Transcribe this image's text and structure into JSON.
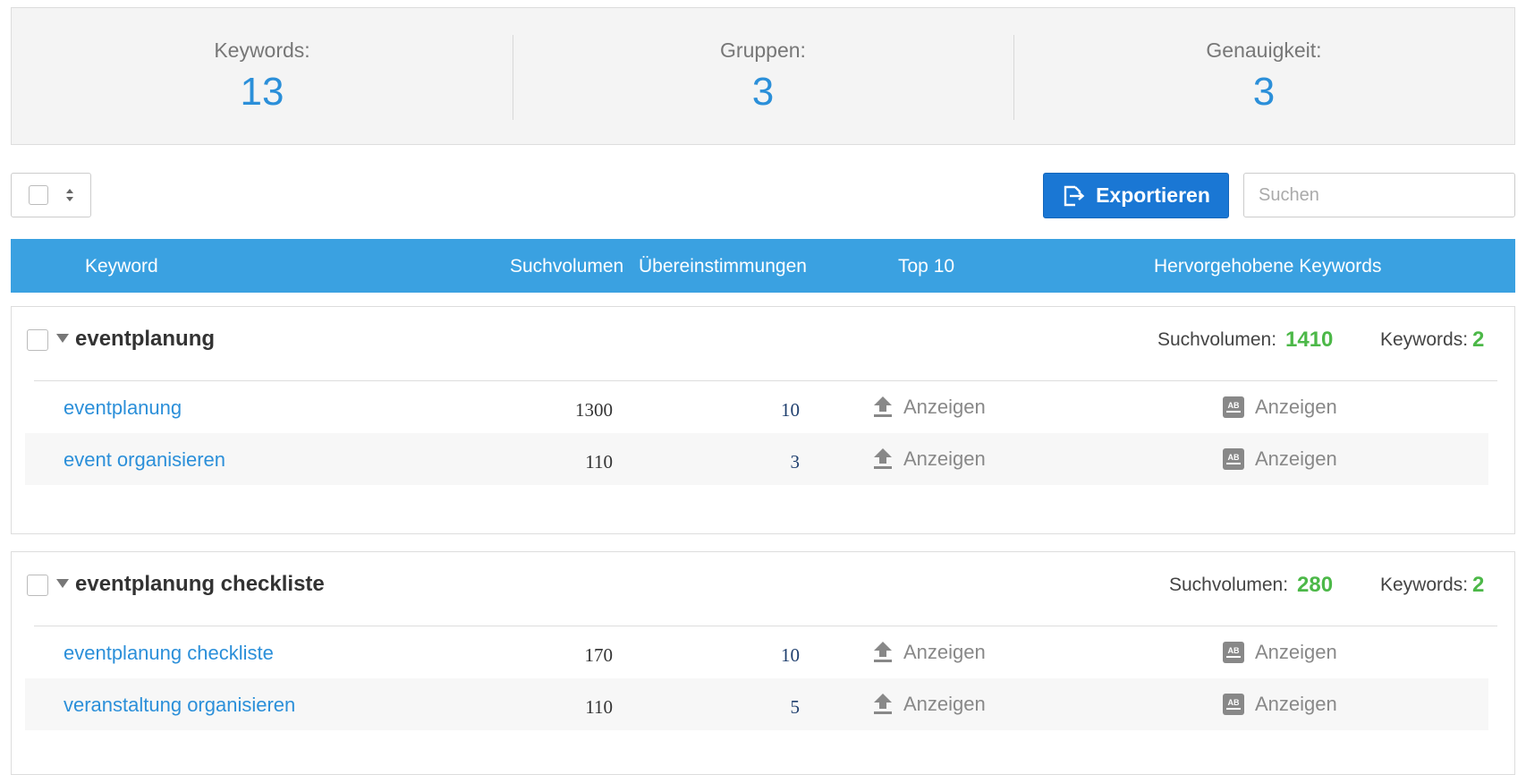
{
  "stats": [
    {
      "label": "Keywords:",
      "value": "13"
    },
    {
      "label": "Gruppen:",
      "value": "3"
    },
    {
      "label": "Genauigkeit:",
      "value": "3"
    }
  ],
  "toolbar": {
    "export_label": "Exportieren",
    "search_placeholder": "Suchen"
  },
  "table": {
    "headers": {
      "keyword": "Keyword",
      "volume": "Suchvolumen",
      "matches": "Übereinstimmungen",
      "top10": "Top 10",
      "highlighted": "Hervorgehobene Keywords"
    }
  },
  "groups": [
    {
      "title": "eventplanung",
      "volume_label": "Suchvolumen:",
      "volume": "1410",
      "keywords_label": "Keywords:",
      "keywords": "2",
      "rows": [
        {
          "keyword": "eventplanung",
          "volume": "1300",
          "matches": "10",
          "top10": "Anzeigen",
          "highlighted": "Anzeigen"
        },
        {
          "keyword": "event organisieren",
          "volume": "110",
          "matches": "3",
          "top10": "Anzeigen",
          "highlighted": "Anzeigen"
        }
      ]
    },
    {
      "title": "eventplanung checkliste",
      "volume_label": "Suchvolumen:",
      "volume": "280",
      "keywords_label": "Keywords:",
      "keywords": "2",
      "rows": [
        {
          "keyword": "eventplanung checkliste",
          "volume": "170",
          "matches": "10",
          "top10": "Anzeigen",
          "highlighted": "Anzeigen"
        },
        {
          "keyword": "veranstaltung organisieren",
          "volume": "110",
          "matches": "5",
          "top10": "Anzeigen",
          "highlighted": "Anzeigen"
        }
      ]
    }
  ],
  "colors": {
    "accent": "#2b8fd9",
    "header_bg": "#3aa1e1",
    "export_bg": "#1a77d4",
    "positive": "#4cb848"
  },
  "icons": [
    "export-icon",
    "sort-icon",
    "collapse-arrow-icon",
    "upload-arrow-icon",
    "ab-text-icon"
  ]
}
